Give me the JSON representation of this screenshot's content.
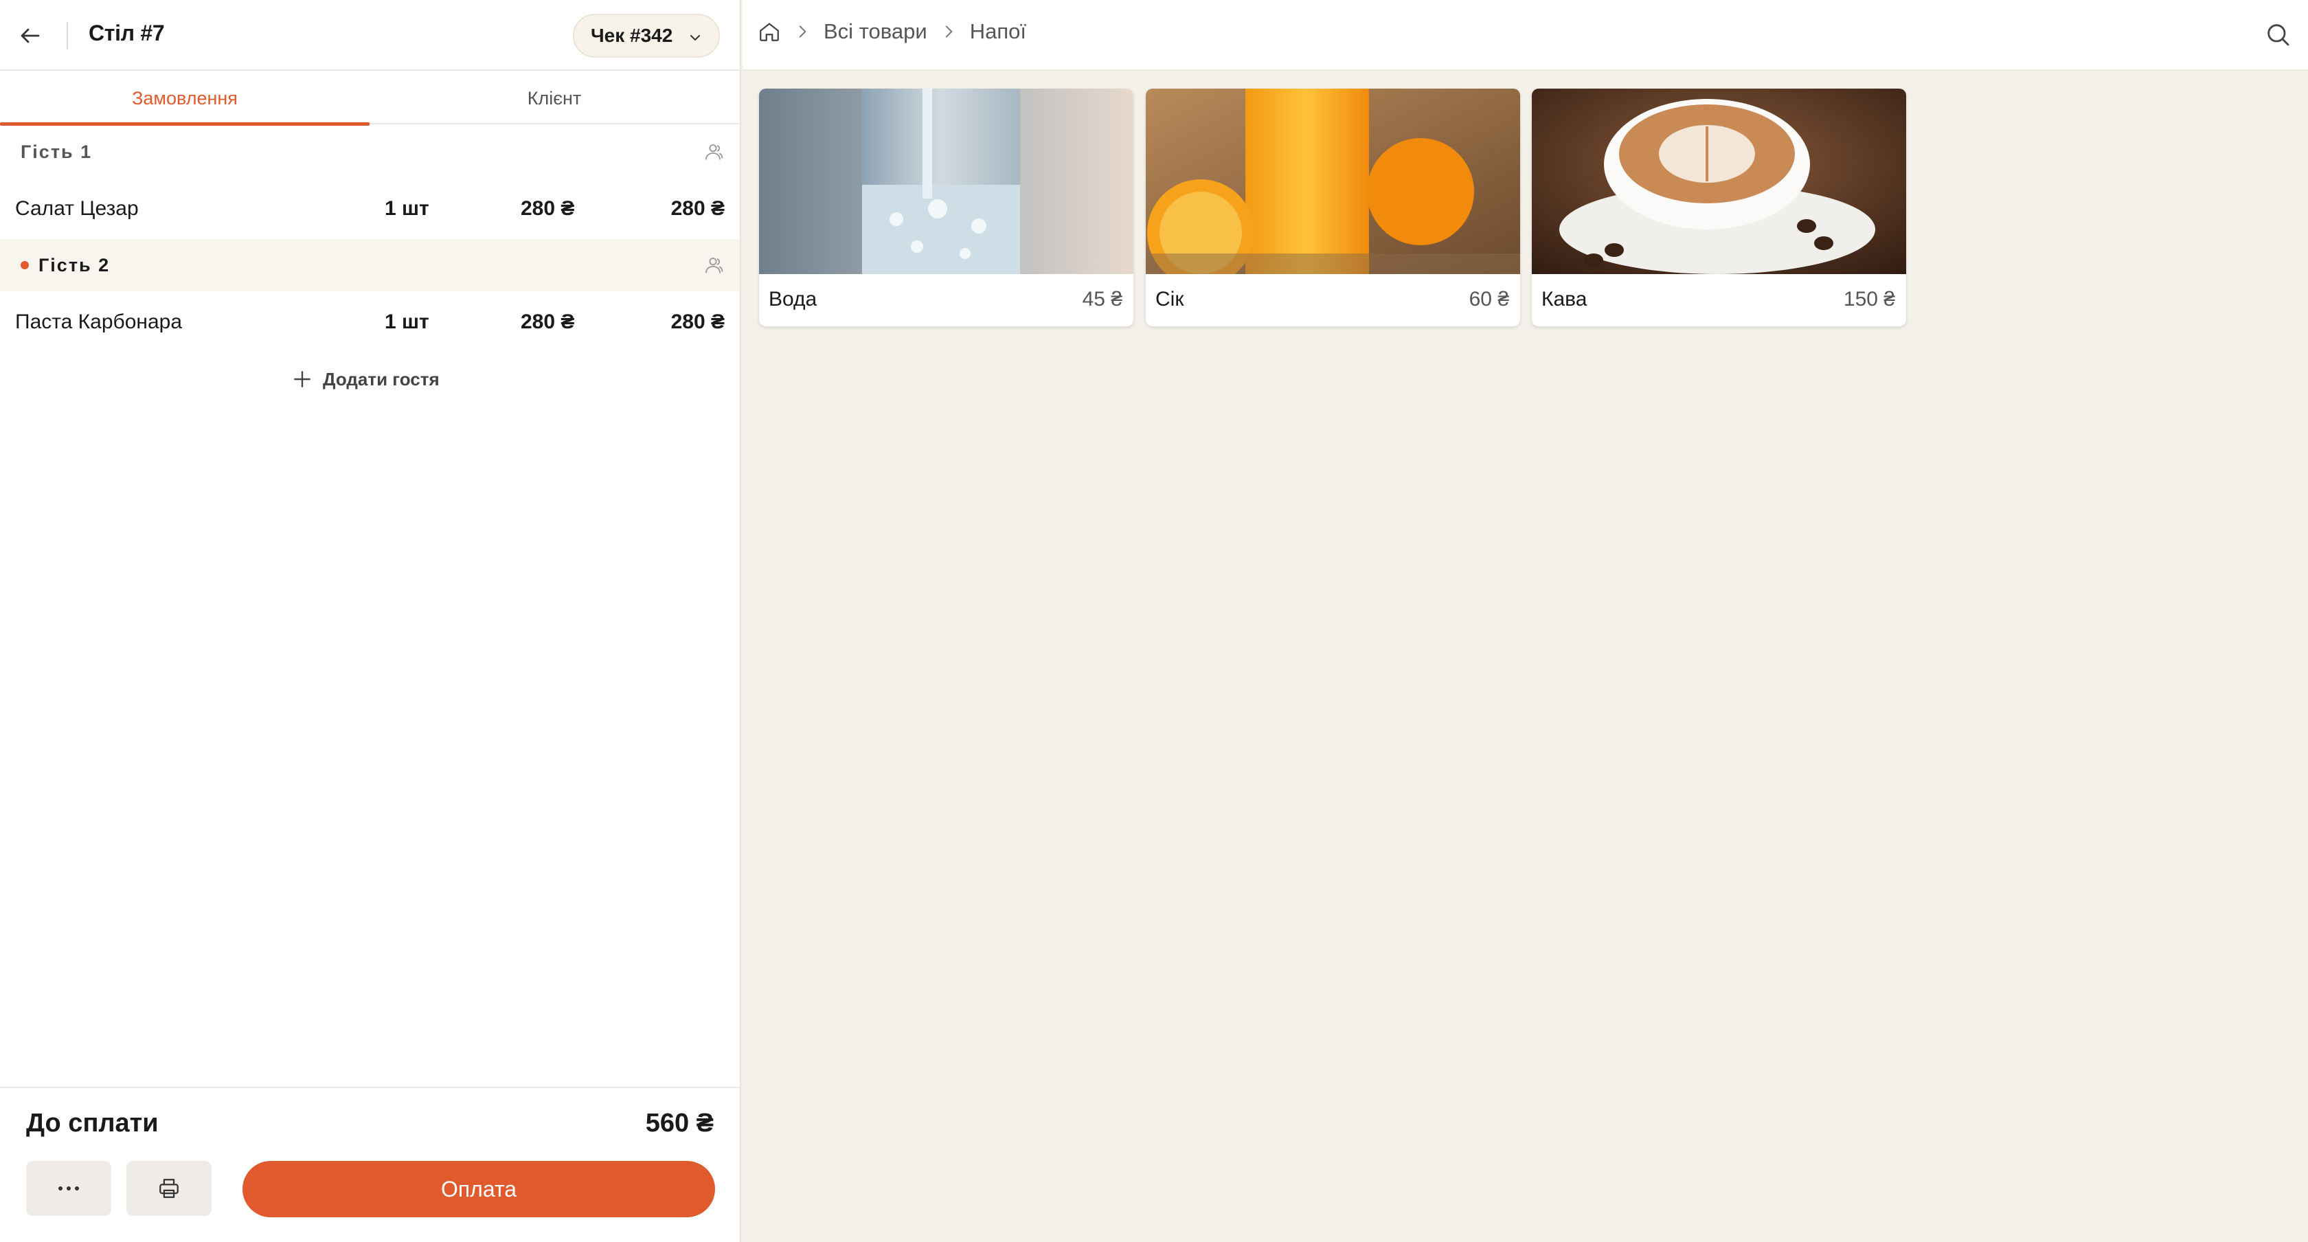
{
  "left_panel": {
    "header": {
      "title": "Стіл #7",
      "check_label": "Чек #342"
    },
    "tabs": [
      {
        "label": "Замовлення",
        "active": true
      },
      {
        "label": "Клієнт",
        "active": false
      }
    ],
    "guests": [
      {
        "label": "Гість 1",
        "active": false,
        "items": [
          {
            "name": "Салат Цезар",
            "qty": "1 шт",
            "price": "280 ₴",
            "total": "280 ₴"
          }
        ]
      },
      {
        "label": "Гість 2",
        "active": true,
        "items": [
          {
            "name": "Паста Карбонара",
            "qty": "1 шт",
            "price": "280 ₴",
            "total": "280 ₴"
          }
        ]
      }
    ],
    "add_guest_label": "Додати гостя",
    "footer": {
      "total_label": "До сплати",
      "total_value": "560 ₴",
      "pay_label": "Оплата"
    }
  },
  "topbar": {
    "breadcrumbs": [
      "Всі товари",
      "Напої"
    ]
  },
  "products": [
    {
      "name": "Вода",
      "price": "45 ₴",
      "image": "glass-of-water"
    },
    {
      "name": "Сік",
      "price": "60 ₴",
      "image": "orange-juice"
    },
    {
      "name": "Кава",
      "price": "150 ₴",
      "image": "latte-cup"
    }
  ],
  "colors": {
    "accent": "#e05a2e",
    "background": "#f4f1ea",
    "panel": "#ffffff"
  }
}
